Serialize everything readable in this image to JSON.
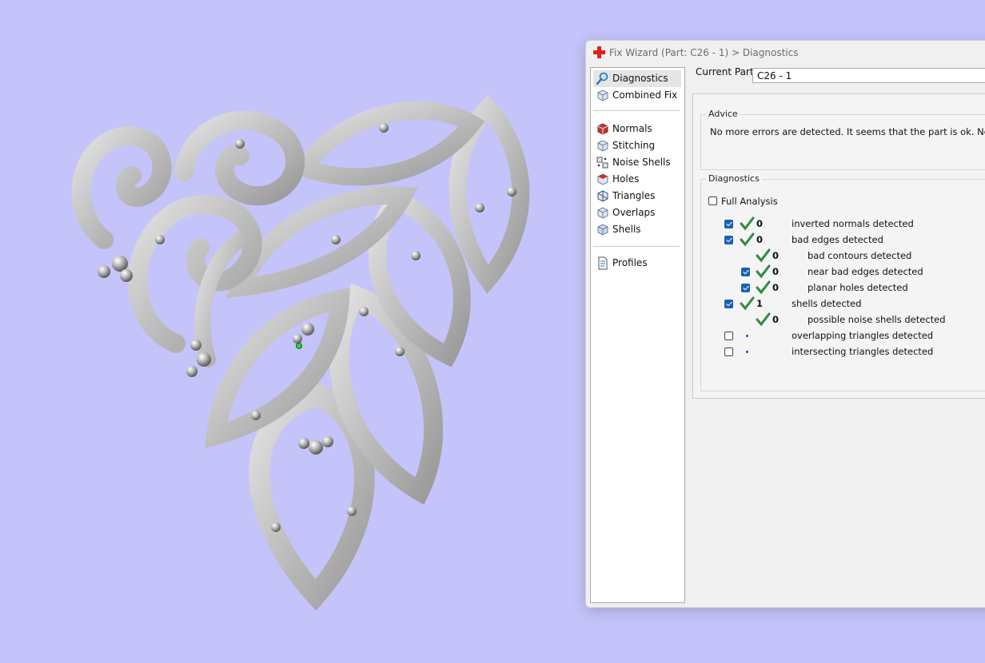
{
  "dialog": {
    "title": "Fix Wizard (Part: C26 - 1) > Diagnostics",
    "current_part_label": "Current Part:",
    "current_part_value": "C26 - 1"
  },
  "nav": {
    "items": [
      {
        "label": "Diagnostics",
        "icon": "magnifier-icon",
        "selected": true
      },
      {
        "label": "Combined Fix",
        "icon": "cube-icon"
      },
      {
        "label": "Normals",
        "icon": "normals-cube-icon"
      },
      {
        "label": "Stitching",
        "icon": "stitching-cube-icon"
      },
      {
        "label": "Noise Shells",
        "icon": "noise-shells-icon"
      },
      {
        "label": "Holes",
        "icon": "holes-cube-icon"
      },
      {
        "label": "Triangles",
        "icon": "triangles-cube-icon"
      },
      {
        "label": "Overlaps",
        "icon": "overlaps-cube-icon"
      },
      {
        "label": "Shells",
        "icon": "shells-cube-icon"
      },
      {
        "label": "Profiles",
        "icon": "document-icon"
      }
    ]
  },
  "advice": {
    "title": "Advice",
    "text": "No more errors are detected. It seems that the part is ok. Note that not"
  },
  "diagnostics": {
    "title": "Diagnostics",
    "full_analysis_label": "Full Analysis",
    "full_analysis_checked": false,
    "rows": [
      {
        "checkbox": true,
        "checked": true,
        "status": "ok",
        "count": "0",
        "label": "inverted normals detected",
        "indent": 0
      },
      {
        "checkbox": true,
        "checked": true,
        "status": "ok",
        "count": "0",
        "label": "bad edges detected",
        "indent": 0
      },
      {
        "checkbox": false,
        "status": "ok",
        "count": "0",
        "label": "bad contours detected",
        "indent": 1
      },
      {
        "checkbox": true,
        "checked": true,
        "status": "ok",
        "count": "0",
        "label": "near bad edges detected",
        "indent": 1
      },
      {
        "checkbox": true,
        "checked": true,
        "status": "ok",
        "count": "0",
        "label": "planar holes detected",
        "indent": 1
      },
      {
        "checkbox": true,
        "checked": true,
        "status": "ok",
        "count": "1",
        "label": "shells detected",
        "indent": 0
      },
      {
        "checkbox": false,
        "status": "ok",
        "count": "0",
        "label": "possible noise shells detected",
        "indent": 1
      },
      {
        "checkbox": true,
        "checked": false,
        "status": "pending",
        "count": "",
        "label": "overlapping triangles detected",
        "indent": 0
      },
      {
        "checkbox": true,
        "checked": false,
        "status": "pending",
        "count": "",
        "label": "intersecting triangles detected",
        "indent": 0
      }
    ]
  },
  "colors": {
    "viewport_bg": "#c4c4fa",
    "check_green": "#2e8b3a",
    "checkbox_blue": "#1a5fb4"
  }
}
